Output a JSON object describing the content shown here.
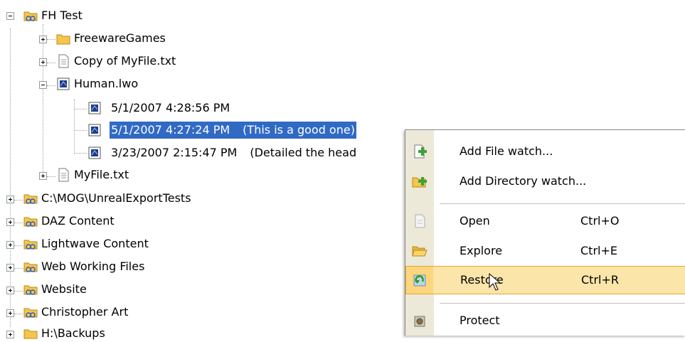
{
  "tree": {
    "root": {
      "label": "FH Test",
      "children": [
        {
          "label": "FreewareGames",
          "icon": "folder-icon"
        },
        {
          "label": "Copy of MyFile.txt",
          "icon": "text-file-icon"
        },
        {
          "label": "Human.lwo",
          "icon": "lwo-file-icon",
          "versions": [
            {
              "label": "5/1/2007 4:28:56 PM",
              "note": ""
            },
            {
              "label": "5/1/2007 4:27:24 PM",
              "note": "(This is a good one)",
              "selected": true
            },
            {
              "label": "3/23/2007 2:15:47 PM",
              "note": "(Detailed the head"
            }
          ]
        },
        {
          "label": "MyFile.txt",
          "icon": "text-file-icon"
        }
      ]
    },
    "watches": [
      {
        "label": "C:\\MOG\\UnrealExportTests"
      },
      {
        "label": "DAZ Content"
      },
      {
        "label": "Lightwave Content"
      },
      {
        "label": "Web Working Files"
      },
      {
        "label": "Website"
      },
      {
        "label": "Christopher Art"
      },
      {
        "label": "H:\\Backups"
      }
    ]
  },
  "context_menu": {
    "items": [
      {
        "label": "Add File watch...",
        "shortcut": "",
        "icon": "add-file-watch-icon"
      },
      {
        "label": "Add Directory watch...",
        "shortcut": "",
        "icon": "add-directory-watch-icon"
      },
      {
        "label": "Open",
        "shortcut": "Ctrl+O",
        "icon": "document-icon"
      },
      {
        "label": "Explore",
        "shortcut": "Ctrl+E",
        "icon": "folder-open-icon"
      },
      {
        "label": "Restore",
        "shortcut": "Ctrl+R",
        "icon": "restore-icon",
        "highlighted": true
      },
      {
        "label": "Protect",
        "shortcut": "",
        "icon": "protect-icon"
      }
    ]
  },
  "colors": {
    "selection": "#316ac5",
    "menu_highlight": "#fbe5a9",
    "menu_highlight_border": "#e3a92b",
    "menu_gutter": "#ece9d8"
  }
}
